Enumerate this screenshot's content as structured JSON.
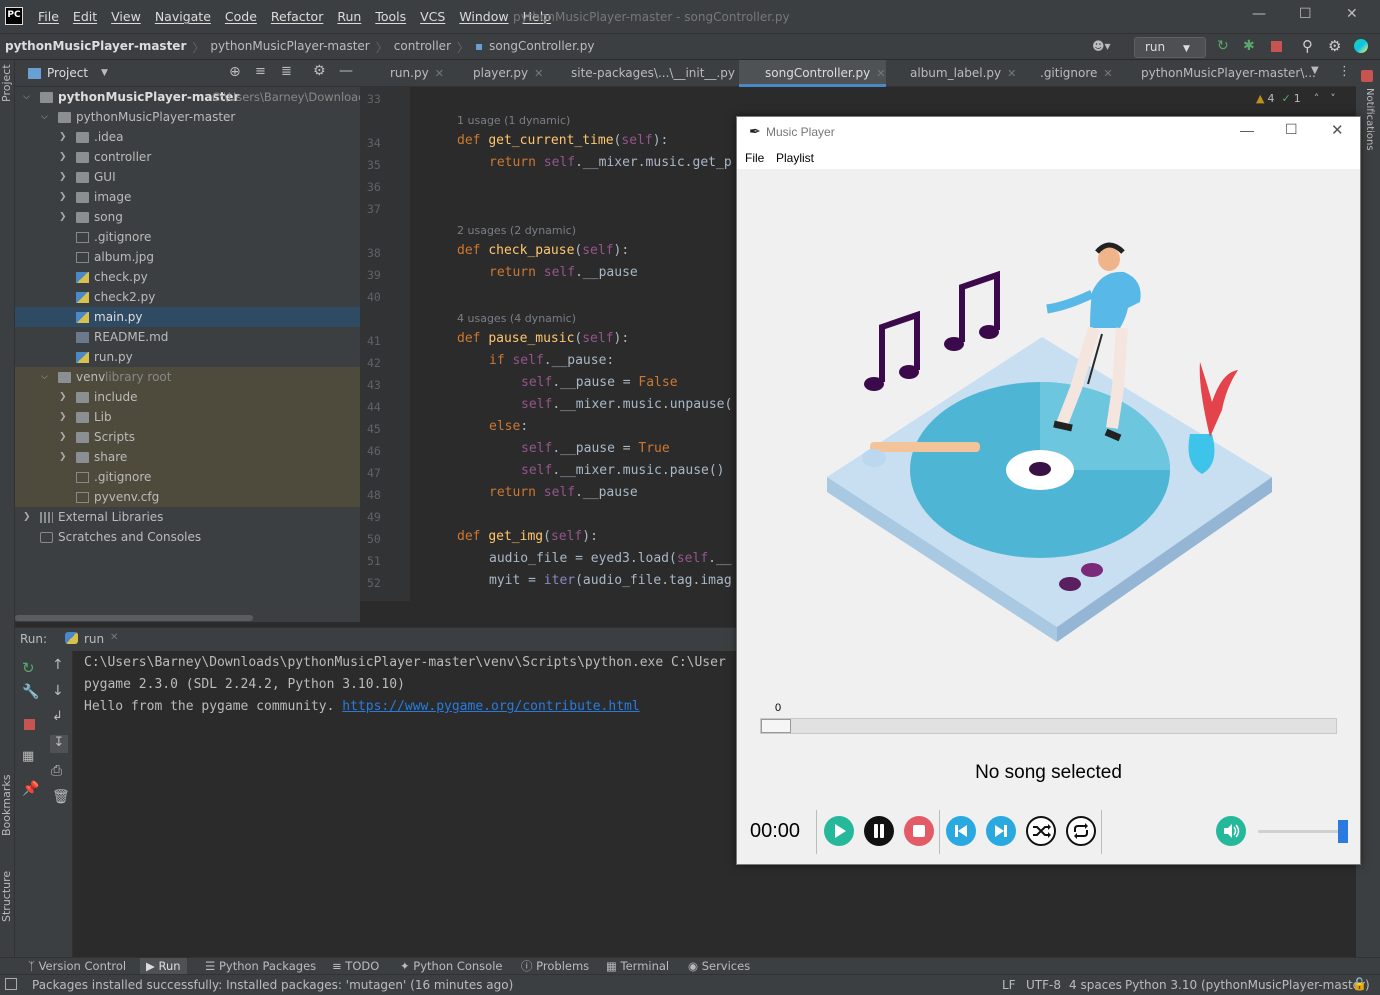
{
  "menubar": {
    "logo": "PC",
    "items": [
      "File",
      "Edit",
      "View",
      "Navigate",
      "Code",
      "Refactor",
      "Run",
      "Tools",
      "VCS",
      "Window",
      "Help"
    ],
    "window_title": "pythonMusicPlayer-master - songController.py"
  },
  "breadcrumb": [
    "pythonMusicPlayer-master",
    "pythonMusicPlayer-master",
    "controller",
    "songController.py"
  ],
  "run_config": "run",
  "project": {
    "header": "Project",
    "root_name": "pythonMusicPlayer-master",
    "root_path": "C:\\Users\\Barney\\Downloads",
    "tree": [
      "pythonMusicPlayer-master",
      ".idea",
      "controller",
      "GUI",
      "image",
      "song",
      ".gitignore",
      "album.jpg",
      "check.py",
      "check2.py",
      "main.py",
      "README.md",
      "run.py",
      "venv",
      "include",
      "Lib",
      "Scripts",
      "share",
      ".gitignore",
      "pyvenv.cfg",
      "External Libraries",
      "Scratches and Consoles"
    ],
    "venv_note": "library root"
  },
  "tabs": [
    "run.py",
    "player.py",
    "site-packages\\...\\__init__.py",
    "songController.py",
    "album_label.py",
    ".gitignore",
    "pythonMusicPlayer-master\\..."
  ],
  "inspections": {
    "warnings": "4",
    "ok": "1"
  },
  "editor": {
    "line_numbers": [
      "33",
      "34",
      "35",
      "36",
      "37",
      "38",
      "39",
      "40",
      "41",
      "42",
      "43",
      "44",
      "45",
      "46",
      "47",
      "48",
      "49",
      "50",
      "51",
      "52"
    ],
    "hints": [
      "1 usage (1 dynamic)",
      "2 usages (2 dynamic)",
      "4 usages (4 dynamic)"
    ]
  },
  "run_panel": {
    "label": "Run:",
    "tab": "run",
    "lines": [
      "C:\\Users\\Barney\\Downloads\\pythonMusicPlayer-master\\venv\\Scripts\\python.exe C:\\User",
      "pygame 2.3.0 (SDL 2.24.2, Python 3.10.10)",
      "Hello from the pygame community. "
    ],
    "link": "https://www.pygame.org/contribute.html"
  },
  "bottom_tools": [
    "Version Control",
    "Run",
    "Python Packages",
    "TODO",
    "Python Console",
    "Problems",
    "Terminal",
    "Services"
  ],
  "status": {
    "message": "Packages installed successfully: Installed packages: 'mutagen' (16 minutes ago)",
    "line_sep": "LF",
    "encoding": "UTF-8",
    "indent": "4 spaces",
    "interpreter": "Python 3.10 (pythonMusicPlayer-master)"
  },
  "side_labels": {
    "project": "Project",
    "bookmarks": "Bookmarks",
    "structure": "Structure",
    "notifications": "Notifications"
  },
  "music_player": {
    "title": "Music Player",
    "menu": [
      "File",
      "Playlist"
    ],
    "slider_value": "0",
    "progress": 0.0,
    "song_label": "No song selected",
    "time": "00:00",
    "volume": 1.0,
    "colors": {
      "play": "#26b89a",
      "stop": "#e35b67",
      "nav": "#2aa8e0",
      "accent": "#2a7ae0"
    }
  }
}
